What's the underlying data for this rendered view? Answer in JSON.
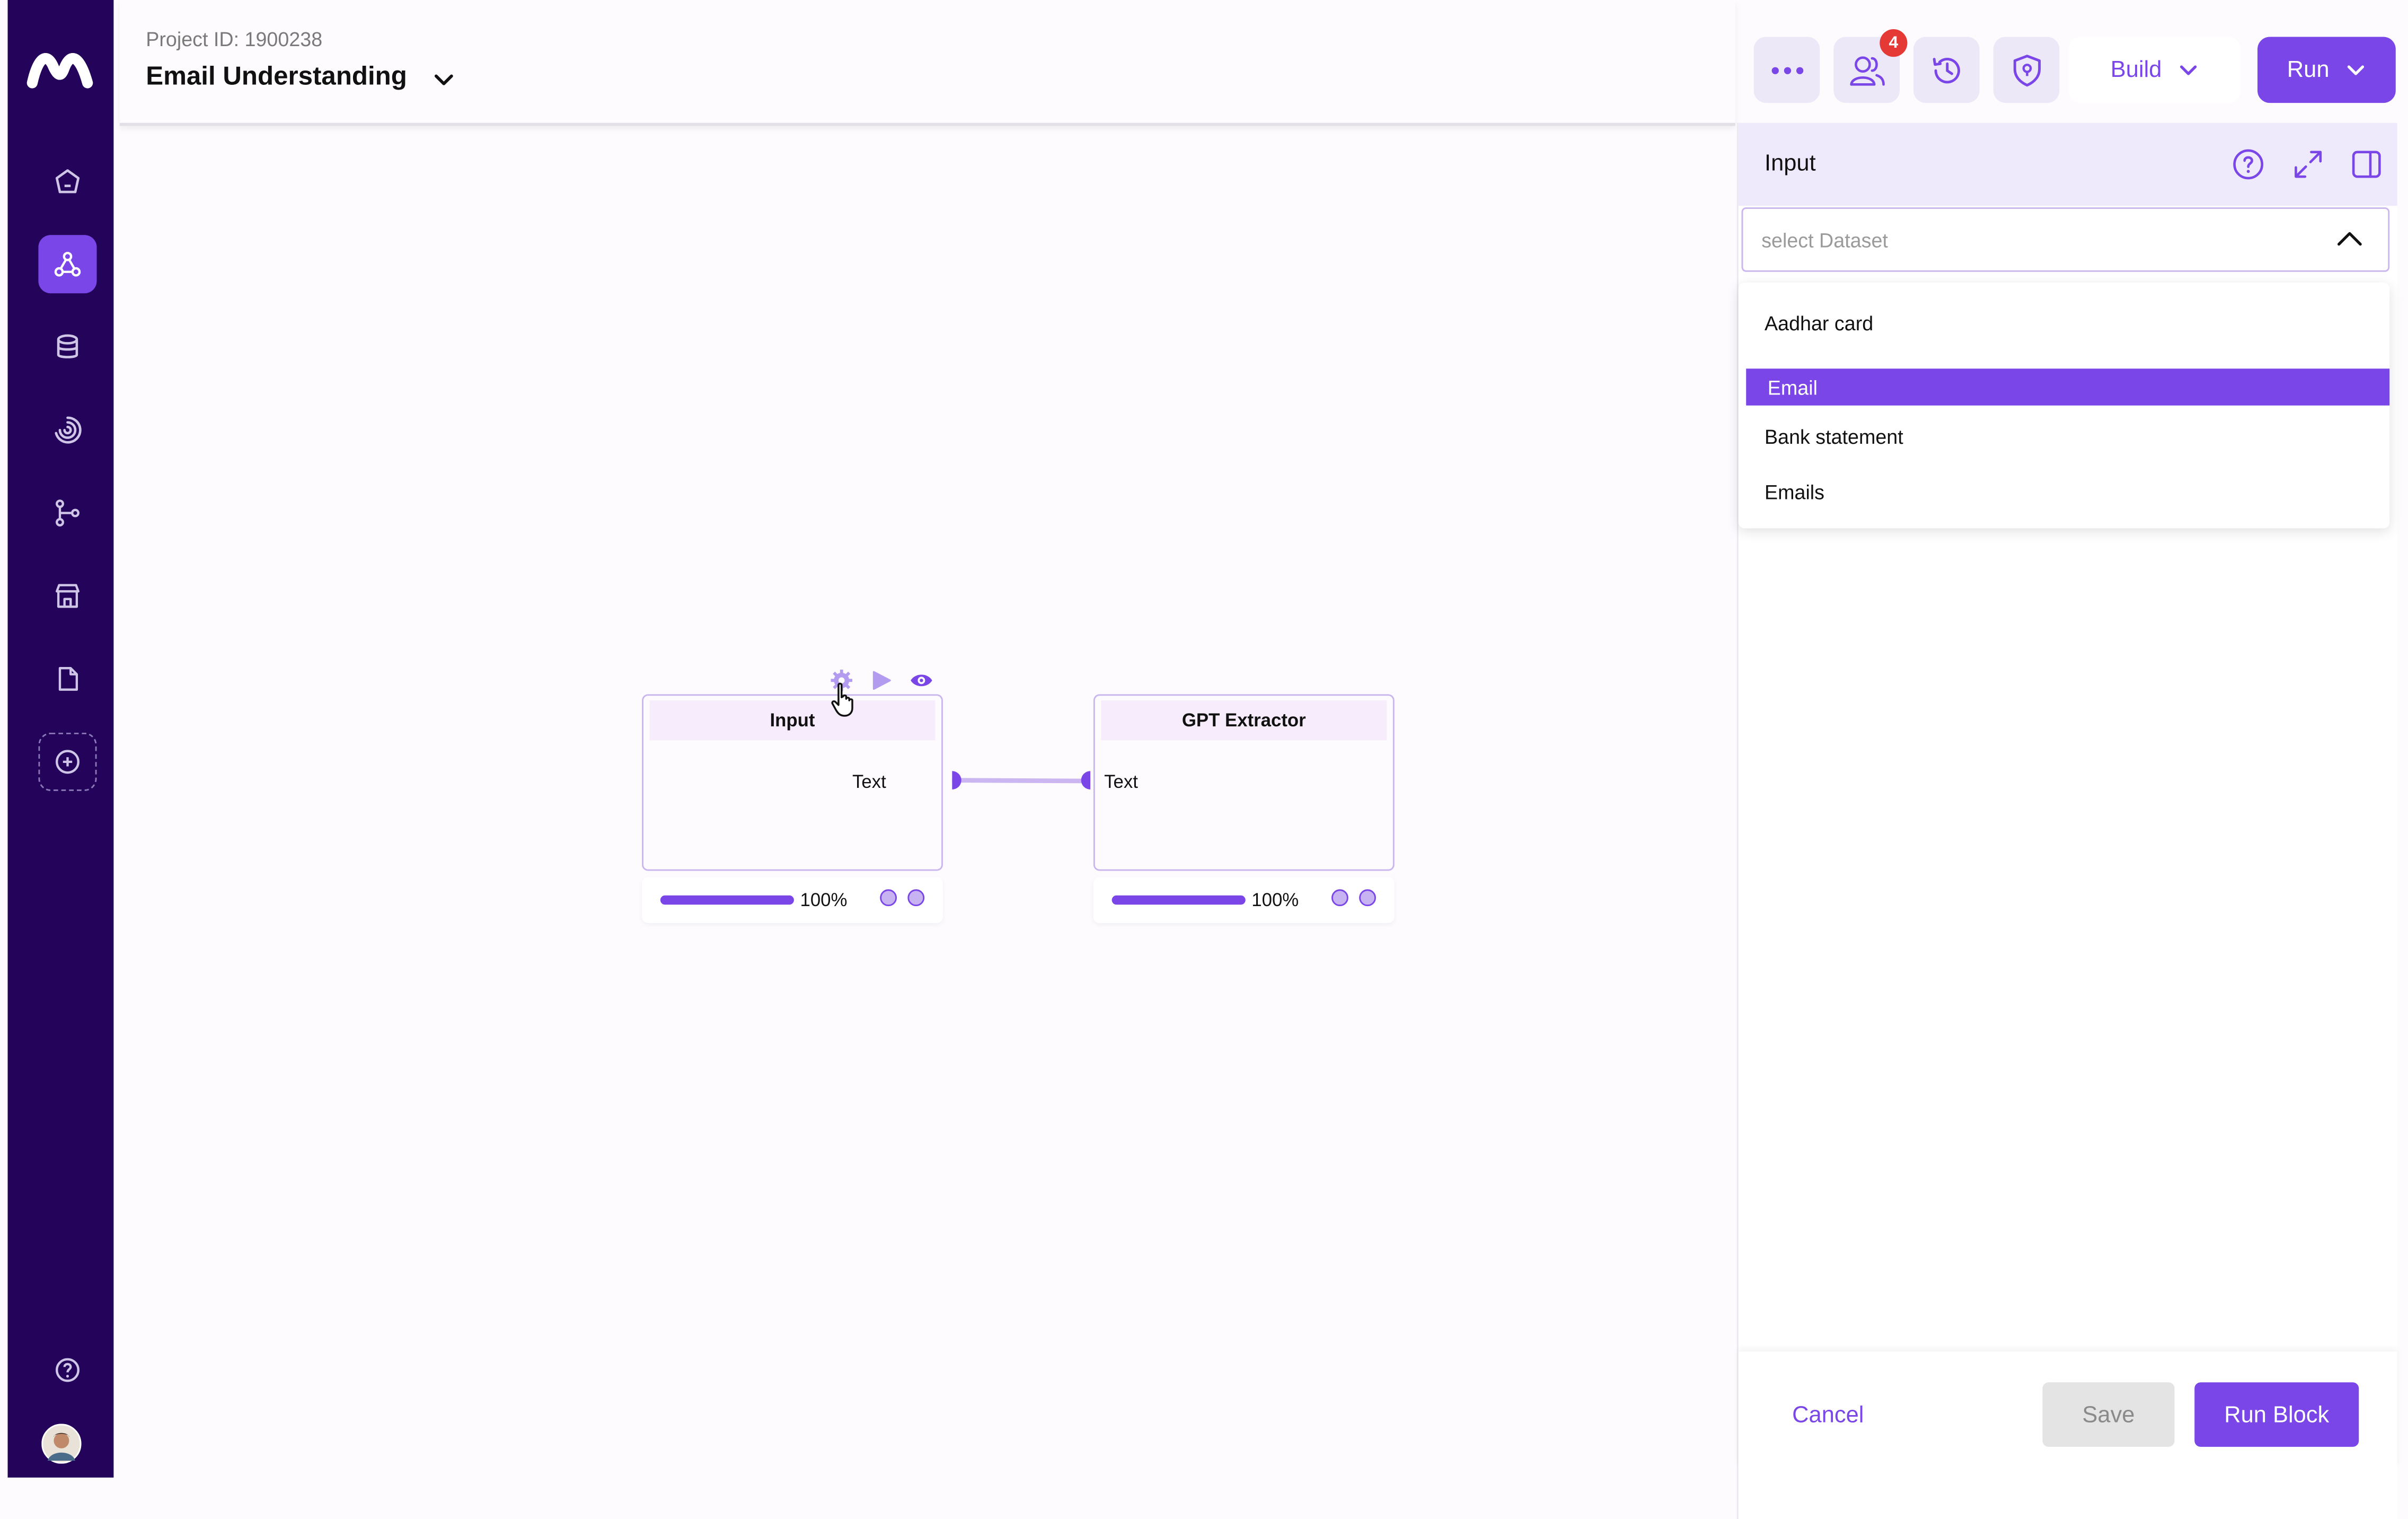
{
  "header": {
    "project_id_label": "Project ID: 1900238",
    "project_title": "Email Understanding",
    "notification_count": "4",
    "build_label": "Build",
    "run_label": "Run"
  },
  "sidebar": {
    "items": [
      {
        "icon": "home-icon"
      },
      {
        "icon": "workflow-icon",
        "active": true
      },
      {
        "icon": "database-icon"
      },
      {
        "icon": "spiral-icon"
      },
      {
        "icon": "branch-icon"
      },
      {
        "icon": "store-icon"
      },
      {
        "icon": "file-icon"
      },
      {
        "icon": "add-icon"
      }
    ],
    "bottom": [
      {
        "icon": "help-icon"
      },
      {
        "icon": "avatar"
      }
    ]
  },
  "canvas": {
    "nodes": [
      {
        "title": "Input",
        "port_label": "Text",
        "progress": 100,
        "progress_label": "100%"
      },
      {
        "title": "GPT Extractor",
        "port_label": "Text",
        "progress": 100,
        "progress_label": "100%"
      }
    ]
  },
  "panel": {
    "title": "Input",
    "select_placeholder": "select Dataset",
    "options": [
      "Aadhar card",
      "Email",
      "Bank statement",
      "Emails"
    ],
    "selected_option": "Email",
    "cancel_label": "Cancel",
    "save_label": "Save",
    "run_block_label": "Run Block"
  },
  "colors": {
    "accent": "#7b46e8",
    "sidebar": "#23045a",
    "badge": "#e53935"
  }
}
